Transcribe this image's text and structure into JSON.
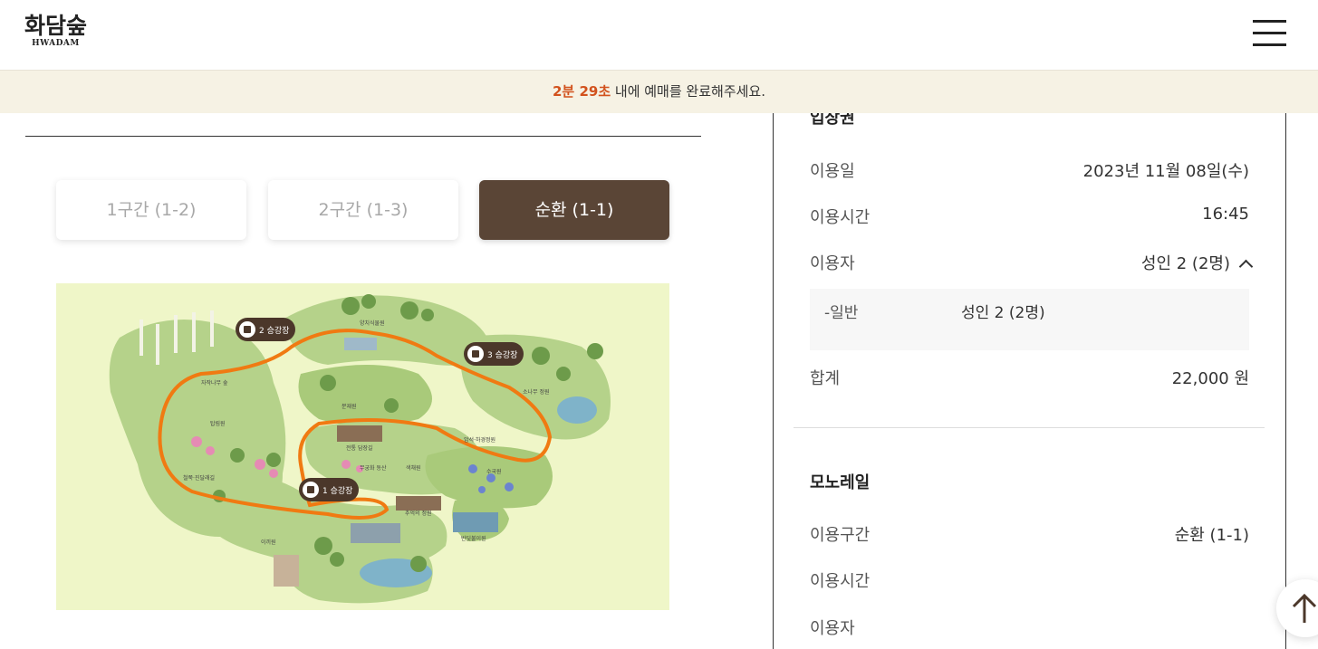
{
  "header": {
    "logo_ko": "화담숲",
    "logo_en": "HWADAM",
    "menu_icon": "hamburger-menu-icon"
  },
  "timer": {
    "time": "2분 29초",
    "message": " 내에 예매를 완료해주세요."
  },
  "route_tabs": [
    {
      "label": "1구간 (1-2)",
      "active": false
    },
    {
      "label": "2구간 (1-3)",
      "active": false
    },
    {
      "label": "순환 (1-1)",
      "active": true
    }
  ],
  "map": {
    "stations": [
      {
        "label": "1 승강장"
      },
      {
        "label": "2 승강장"
      },
      {
        "label": "3 승강장"
      }
    ],
    "areas": [
      "양치식물원",
      "자작나무 숲",
      "분재원",
      "소나무 정원",
      "탑림원",
      "전통 담장길",
      "암석·하경정원",
      "철쭉·진달래길",
      "무궁화 동산",
      "색채원",
      "수국원",
      "추억의 정원",
      "이끼원",
      "반딧불이원"
    ],
    "colors": {
      "background": "#eff6c8",
      "route": "#f07a12",
      "land": "#b5d28a"
    }
  },
  "summary": {
    "ticket_section": {
      "title": "입장권",
      "date_label": "이용일",
      "date_value": "2023년 11월 08일(수)",
      "time_label": "이용시간",
      "time_value": "16:45",
      "user_label": "이용자",
      "user_value": "성인 2 (2명)",
      "detail_label": "-일반",
      "detail_value": "성인 2 (2명)",
      "total_label": "합계",
      "total_value": "22,000 원"
    },
    "monorail_section": {
      "title": "모노레일",
      "route_label": "이용구간",
      "route_value": "순환 (1-1)",
      "time_label": "이용시간",
      "user_label": "이용자"
    }
  },
  "colors": {
    "timer_bg": "#f6f2e4",
    "timer_accent": "#d2521d",
    "active_tab": "#5a4536"
  },
  "scroll_top_icon": "arrow-up-icon"
}
